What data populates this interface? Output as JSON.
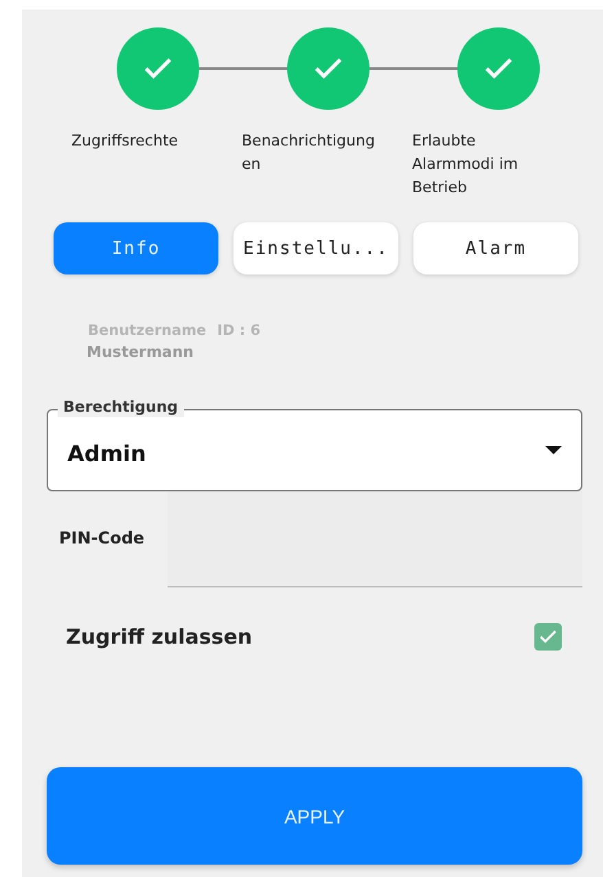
{
  "steps": [
    {
      "label": "Zugriffsrechte",
      "done": true
    },
    {
      "label": "Benachrichtigung\nen",
      "done": true
    },
    {
      "label": "Erlaubte\nAlarmmodi im\nBetrieb",
      "done": true
    }
  ],
  "tabs": [
    {
      "label": "Info",
      "selected": true
    },
    {
      "label": "Einstellu...",
      "selected": false
    },
    {
      "label": "Alarm",
      "selected": false
    }
  ],
  "user": {
    "label": "Benutzername",
    "id": "ID : 6",
    "name": "Mustermann"
  },
  "permission": {
    "legend": "Berechtigung",
    "value": "Admin"
  },
  "pin": {
    "label": "PIN-Code"
  },
  "access": {
    "label": "Zugriff zulassen",
    "checked": true
  },
  "apply_button": "APPLY"
}
